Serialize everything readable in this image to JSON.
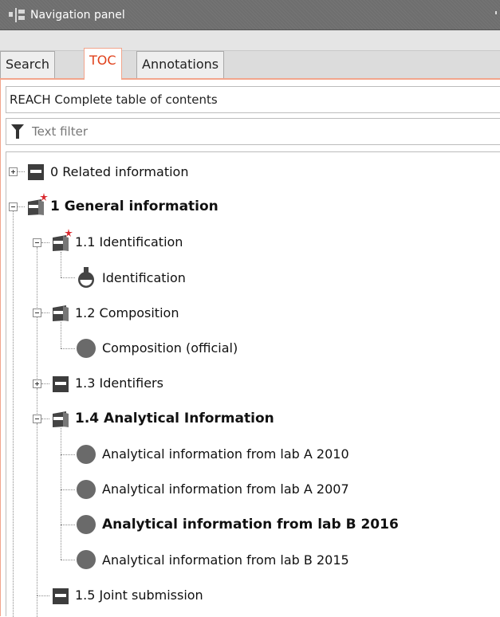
{
  "titlebar": {
    "title": "Navigation panel",
    "icon": "navigation-panel-icon"
  },
  "tabs": [
    {
      "label": "Search",
      "active": false
    },
    {
      "label": "TOC",
      "active": true
    },
    {
      "label": "Annotations",
      "active": false
    }
  ],
  "toc_select": {
    "value": "REACH Complete table of contents"
  },
  "filter": {
    "placeholder": "Text filter",
    "icon": "funnel-icon"
  },
  "tree": [
    {
      "label": "0 Related information",
      "level": 0,
      "icon": "section-doc",
      "expander": "plus",
      "bold": false,
      "required": false
    },
    {
      "label": "1 General information",
      "level": 0,
      "icon": "section-doc-open",
      "expander": "minus",
      "bold": true,
      "required": true
    },
    {
      "label": "1.1 Identification",
      "level": 1,
      "icon": "section-doc-open",
      "expander": "minus",
      "bold": false,
      "required": true
    },
    {
      "label": "Identification",
      "level": 2,
      "icon": "flask",
      "expander": null,
      "bold": false,
      "required": false
    },
    {
      "label": "1.2 Composition",
      "level": 1,
      "icon": "section-doc-open",
      "expander": "minus",
      "bold": false,
      "required": false
    },
    {
      "label": "Composition (official)",
      "level": 2,
      "icon": "record",
      "expander": null,
      "bold": false,
      "required": false
    },
    {
      "label": "1.3 Identifiers",
      "level": 1,
      "icon": "section-doc",
      "expander": "plus",
      "bold": false,
      "required": false
    },
    {
      "label": "1.4 Analytical Information",
      "level": 1,
      "icon": "section-doc-open",
      "expander": "minus",
      "bold": true,
      "required": false
    },
    {
      "label": "Analytical information from lab A 2010",
      "level": 2,
      "icon": "record",
      "expander": null,
      "bold": false,
      "required": false
    },
    {
      "label": "Analytical information from lab A 2007",
      "level": 2,
      "icon": "record",
      "expander": null,
      "bold": false,
      "required": false
    },
    {
      "label": "Analytical information from lab B 2016",
      "level": 2,
      "icon": "record",
      "expander": null,
      "bold": true,
      "required": false
    },
    {
      "label": "Analytical information from lab B 2015",
      "level": 2,
      "icon": "record",
      "expander": null,
      "bold": false,
      "required": false
    },
    {
      "label": "1.5 Joint submission",
      "level": 1,
      "icon": "section-doc",
      "expander": null,
      "bold": false,
      "required": false
    }
  ],
  "colors": {
    "accent": "#e0401a",
    "tab_border": "#f2a58c",
    "titlebar": "#6e6e6e",
    "required_star": "#d9262c"
  }
}
